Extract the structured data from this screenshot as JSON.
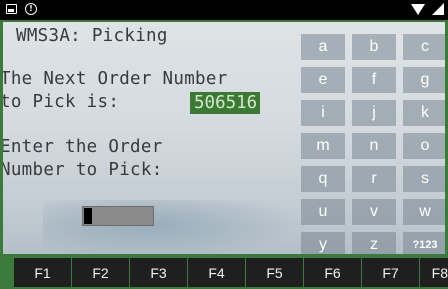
{
  "status_bar": {
    "left_icons": [
      "image-icon",
      "info-icon"
    ],
    "right_icons": [
      "wifi-icon",
      "signal-icon"
    ]
  },
  "screen": {
    "title": "WMS3A: Picking",
    "prompt_line1": "The Next Order Number",
    "prompt_line2": "to Pick is:",
    "next_order_number": "506516",
    "prompt_line3": "Enter the Order",
    "prompt_line4": "Number to Pick:",
    "order_input_value": ""
  },
  "keyboard": {
    "keys": [
      "a",
      "b",
      "c",
      "e",
      "f",
      "g",
      "i",
      "j",
      "k",
      "m",
      "n",
      "o",
      "q",
      "r",
      "s",
      "u",
      "v",
      "w",
      "y",
      "z",
      "?123"
    ]
  },
  "function_keys": [
    "F1",
    "F2",
    "F3",
    "F4",
    "F5",
    "F6",
    "F7",
    "F8"
  ],
  "colors": {
    "frame_green": "#3c7a3c",
    "highlight_green": "#3b7a33",
    "fkey_background": "#1f1f1f"
  }
}
